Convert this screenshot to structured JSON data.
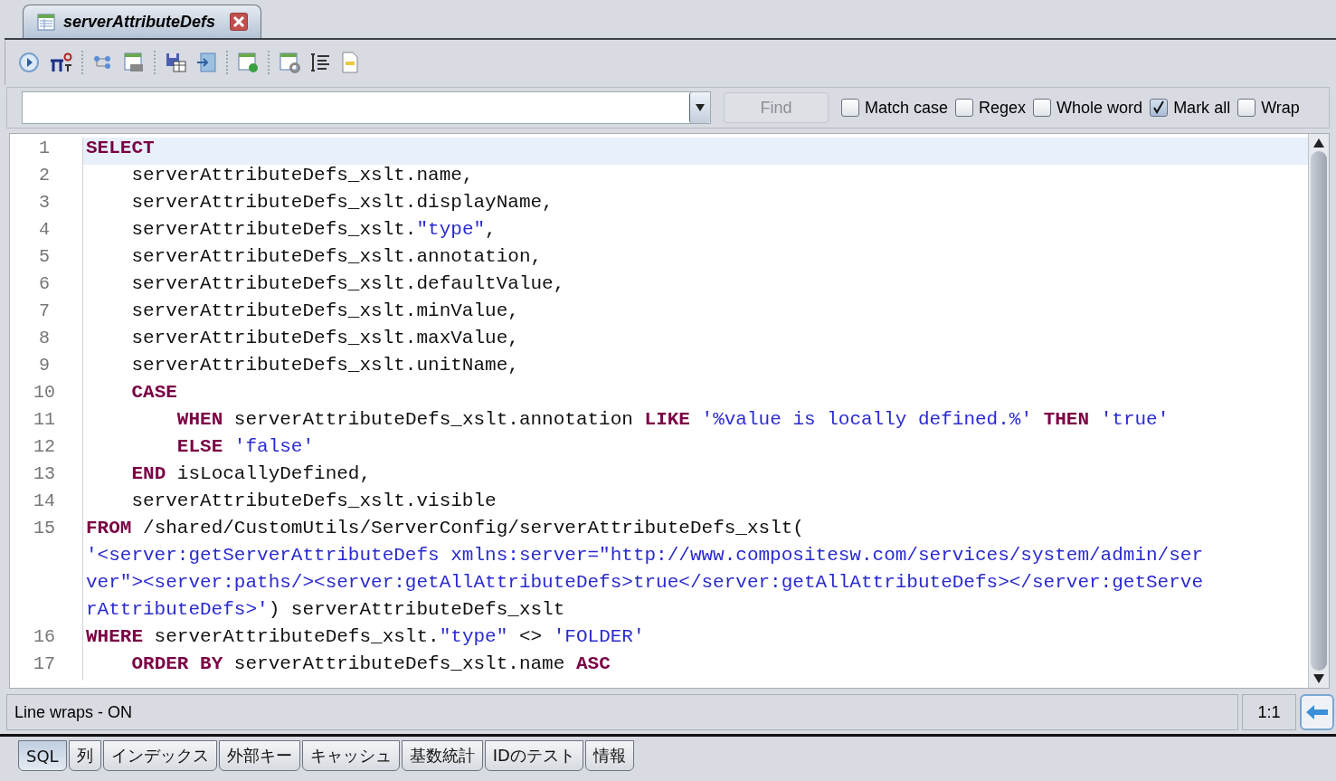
{
  "document_tab": {
    "title": "serverAttributeDefs",
    "selected": true
  },
  "find_bar": {
    "button": "Find",
    "disabled": true,
    "options": [
      {
        "label": "Match case",
        "checked": false
      },
      {
        "label": "Regex",
        "checked": false
      },
      {
        "label": "Whole word",
        "checked": false
      },
      {
        "label": "Mark all",
        "checked": true
      },
      {
        "label": "Wrap",
        "checked": false
      }
    ]
  },
  "editor": {
    "lines": [
      {
        "number": "1",
        "selected": true,
        "rows": [
          [
            {
              "kind": "kw",
              "text": "SELECT"
            }
          ]
        ]
      },
      {
        "number": "2",
        "selected": false,
        "rows": [
          [
            {
              "kind": "plain",
              "text": "    serverAttributeDefs_xslt.name,"
            }
          ]
        ]
      },
      {
        "number": "3",
        "selected": false,
        "rows": [
          [
            {
              "kind": "plain",
              "text": "    serverAttributeDefs_xslt.displayName,"
            }
          ]
        ]
      },
      {
        "number": "4",
        "selected": false,
        "rows": [
          [
            {
              "kind": "plain",
              "text": "    serverAttributeDefs_xslt."
            },
            {
              "kind": "str",
              "text": "\"type\""
            },
            {
              "kind": "plain",
              "text": ","
            }
          ]
        ]
      },
      {
        "number": "5",
        "selected": false,
        "rows": [
          [
            {
              "kind": "plain",
              "text": "    serverAttributeDefs_xslt.annotation,"
            }
          ]
        ]
      },
      {
        "number": "6",
        "selected": false,
        "rows": [
          [
            {
              "kind": "plain",
              "text": "    serverAttributeDefs_xslt.defaultValue,"
            }
          ]
        ]
      },
      {
        "number": "7",
        "selected": false,
        "rows": [
          [
            {
              "kind": "plain",
              "text": "    serverAttributeDefs_xslt.minValue,"
            }
          ]
        ]
      },
      {
        "number": "8",
        "selected": false,
        "rows": [
          [
            {
              "kind": "plain",
              "text": "    serverAttributeDefs_xslt.maxValue,"
            }
          ]
        ]
      },
      {
        "number": "9",
        "selected": false,
        "rows": [
          [
            {
              "kind": "plain",
              "text": "    serverAttributeDefs_xslt.unitName,"
            }
          ]
        ]
      },
      {
        "number": "10",
        "selected": false,
        "rows": [
          [
            {
              "kind": "plain",
              "text": "    "
            },
            {
              "kind": "kw",
              "text": "CASE"
            }
          ]
        ]
      },
      {
        "number": "11",
        "selected": false,
        "rows": [
          [
            {
              "kind": "plain",
              "text": "        "
            },
            {
              "kind": "kw",
              "text": "WHEN"
            },
            {
              "kind": "plain",
              "text": " serverAttributeDefs_xslt.annotation "
            },
            {
              "kind": "kw",
              "text": "LIKE"
            },
            {
              "kind": "plain",
              "text": " "
            },
            {
              "kind": "str",
              "text": "'%value is locally defined.%'"
            },
            {
              "kind": "plain",
              "text": " "
            },
            {
              "kind": "kw",
              "text": "THEN"
            },
            {
              "kind": "plain",
              "text": " "
            },
            {
              "kind": "str",
              "text": "'true'"
            }
          ]
        ]
      },
      {
        "number": "12",
        "selected": false,
        "rows": [
          [
            {
              "kind": "plain",
              "text": "        "
            },
            {
              "kind": "kw",
              "text": "ELSE"
            },
            {
              "kind": "plain",
              "text": " "
            },
            {
              "kind": "str",
              "text": "'false'"
            }
          ]
        ]
      },
      {
        "number": "13",
        "selected": false,
        "rows": [
          [
            {
              "kind": "plain",
              "text": "    "
            },
            {
              "kind": "kw",
              "text": "END"
            },
            {
              "kind": "plain",
              "text": " isLocallyDefined,"
            }
          ]
        ]
      },
      {
        "number": "14",
        "selected": false,
        "rows": [
          [
            {
              "kind": "plain",
              "text": "    serverAttributeDefs_xslt.visible"
            }
          ]
        ]
      },
      {
        "number": "15",
        "selected": false,
        "rows": [
          [
            {
              "kind": "kw",
              "text": "FROM"
            },
            {
              "kind": "plain",
              "text": " /shared/CustomUtils/ServerConfig/serverAttributeDefs_xslt("
            }
          ],
          [
            {
              "kind": "str",
              "text": "'<server:getServerAttributeDefs xmlns:server=\"http://www.compositesw.com/services/system/admin/ser"
            }
          ],
          [
            {
              "kind": "str",
              "text": "ver\"><server:paths/><server:getAllAttributeDefs>true</server:getAllAttributeDefs></server:getServe"
            }
          ],
          [
            {
              "kind": "str",
              "text": "rAttributeDefs>'"
            },
            {
              "kind": "plain",
              "text": ") serverAttributeDefs_xslt"
            }
          ]
        ]
      },
      {
        "number": "16",
        "selected": false,
        "rows": [
          [
            {
              "kind": "kw",
              "text": "WHERE"
            },
            {
              "kind": "plain",
              "text": " serverAttributeDefs_xslt."
            },
            {
              "kind": "str",
              "text": "\"type\""
            },
            {
              "kind": "plain",
              "text": " <> "
            },
            {
              "kind": "str",
              "text": "'FOLDER'"
            }
          ]
        ]
      },
      {
        "number": "17",
        "selected": false,
        "rows": [
          [
            {
              "kind": "plain",
              "text": "    "
            },
            {
              "kind": "kw",
              "text": "ORDER BY"
            },
            {
              "kind": "plain",
              "text": " serverAttributeDefs_xslt.name "
            },
            {
              "kind": "kw",
              "text": "ASC"
            }
          ]
        ]
      }
    ]
  },
  "status_bar": {
    "message": "Line wraps - ON",
    "position": "1:1"
  },
  "bottom_tabs": [
    {
      "label": "SQL",
      "selected": true
    },
    {
      "label": "列",
      "selected": false
    },
    {
      "label": "インデックス",
      "selected": false
    },
    {
      "label": "外部キー",
      "selected": false
    },
    {
      "label": "キャッシュ",
      "selected": false
    },
    {
      "label": "基数統計",
      "selected": false
    },
    {
      "label": "IDのテスト",
      "selected": false
    },
    {
      "label": "情報",
      "selected": false
    }
  ]
}
